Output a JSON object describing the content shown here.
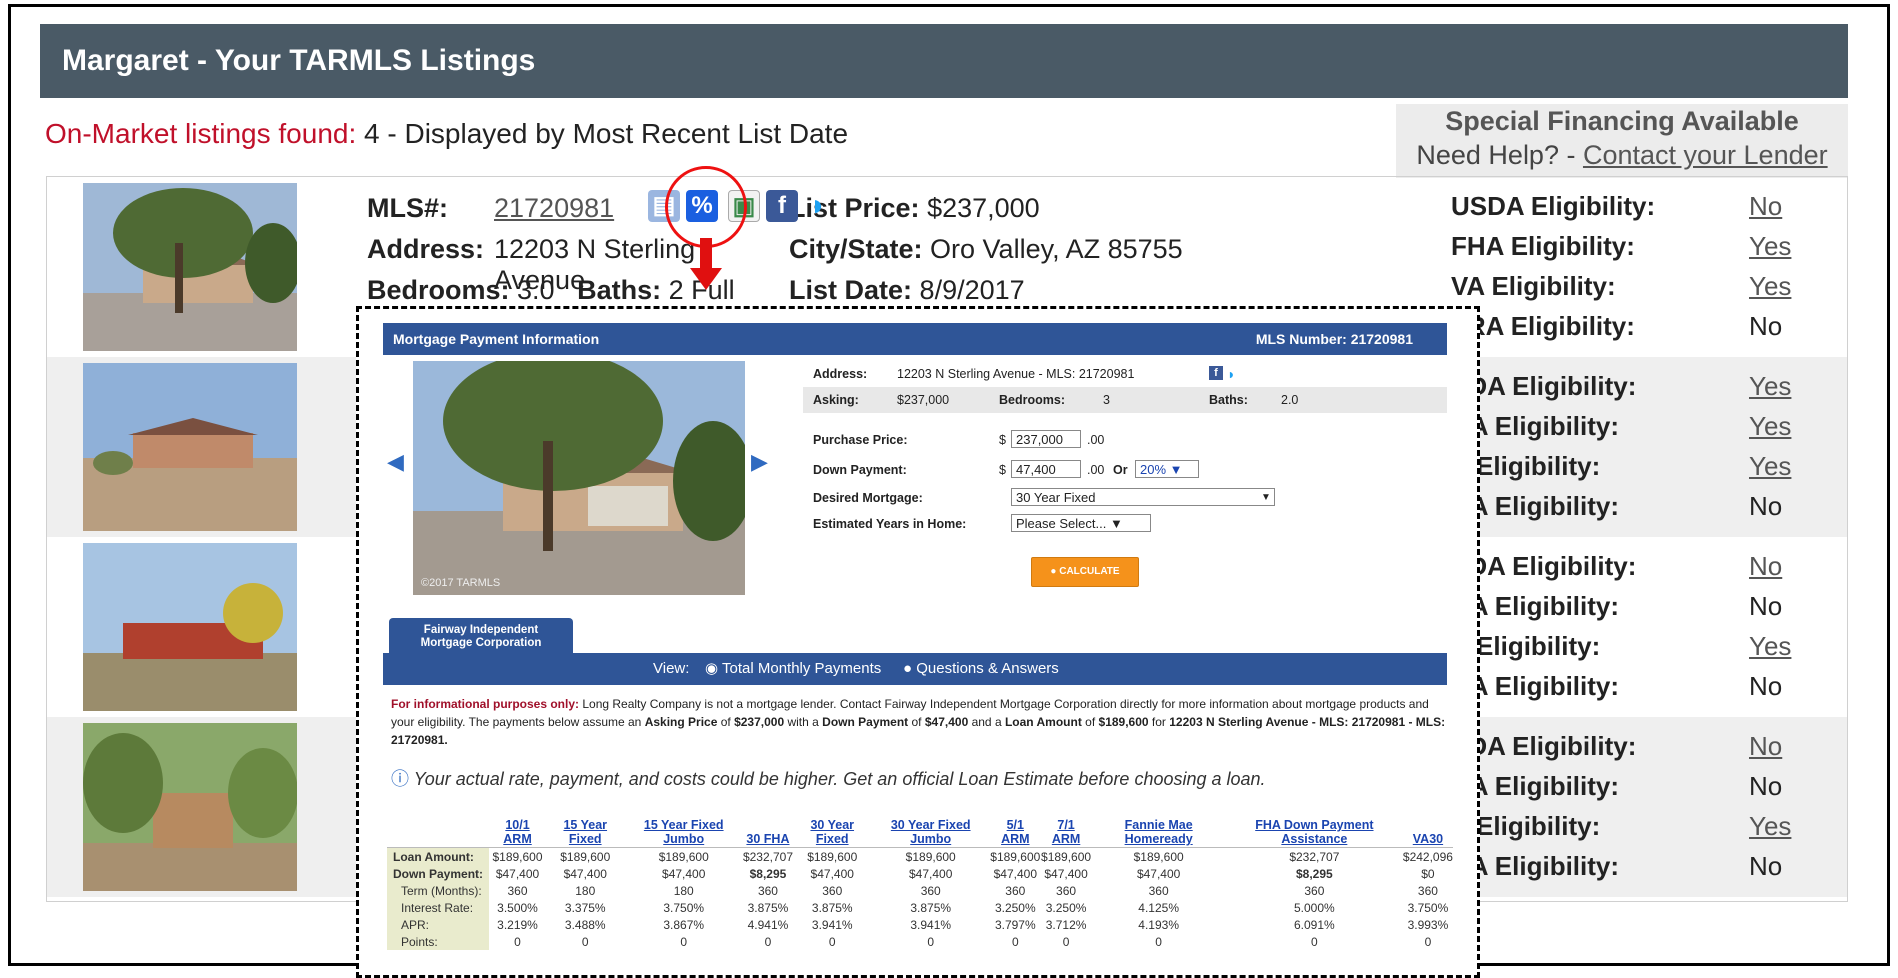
{
  "header": {
    "title": "Margaret - Your TARMLS Listings"
  },
  "found": {
    "label": "On-Market listings found:",
    "count_text": "4 - Displayed by Most Recent List Date"
  },
  "special": {
    "line1": "Special Financing Available",
    "prefix": "Need Help? - ",
    "link": "Contact your Lender"
  },
  "listing1": {
    "mls_label": "MLS#:",
    "mls_number": "21720981",
    "address_label": "Address:",
    "address": "12203 N Sterling Avenue",
    "bedrooms_label": "Bedrooms:",
    "bedrooms": "3.0",
    "baths_label": "Baths:",
    "baths": "2 Full",
    "price_label": "List Price:",
    "price": "$237,000",
    "city_label": "City/State:",
    "city": "Oro Valley, AZ 85755",
    "date_label": "List Date:",
    "date": "8/9/2017"
  },
  "eligibility_labels": {
    "usda": "USDA Eligibility:",
    "fha": "FHA Eligibility:",
    "va": "VA Eligibility:",
    "fra": "FRA Eligibility:"
  },
  "eligibility_partial_labels": {
    "usda": "SDA Eligibility:",
    "fha": "HA Eligibility:",
    "va": "A Eligibility:",
    "fra": "RA Eligibility:"
  },
  "eligibility": [
    {
      "usda": "No",
      "fha": "Yes",
      "va": "Yes",
      "fra": "No"
    },
    {
      "usda": "Yes",
      "fha": "Yes",
      "va": "Yes",
      "fra": "No"
    },
    {
      "usda": "No",
      "fha": "No",
      "va": "Yes",
      "fra": "No"
    },
    {
      "usda": "No",
      "fha": "No",
      "va": "Yes",
      "fra": "No"
    }
  ],
  "icons": [
    "document-icon",
    "percent-icon",
    "photos-icon",
    "facebook-icon",
    "twitter-icon"
  ],
  "popup": {
    "title": "Mortgage Payment Information",
    "mls_number_text": "MLS Number: 21720981",
    "address_label": "Address:",
    "address": "12203 N Sterling Avenue - MLS: 21720981",
    "asking_label": "Asking:",
    "asking": "$237,000",
    "bedrooms_label": "Bedrooms:",
    "bedrooms": "3",
    "baths_label": "Baths:",
    "baths": "2.0",
    "purchase_label": "Purchase Price:",
    "purchase_value": "237,000",
    "down_label": "Down Payment:",
    "down_value": "47,400",
    "dollar": "$",
    "cents": ".00",
    "or": "Or",
    "down_percent": "20% ▼",
    "mortgage_label": "Desired Mortgage:",
    "mortgage_value": "30 Year Fixed",
    "years_label": "Estimated Years in Home:",
    "years_value": "Please Select... ▼",
    "calculate": "CALCULATE",
    "photo_credit": "©2017 TARMLS",
    "tab_line1": "Fairway Independent",
    "tab_line2": "Mortgage Corporation",
    "view_label": "View:",
    "view_opt1": "Total Monthly Payments",
    "view_opt2": "Questions & Answers",
    "note_bold": "For informational purposes only:",
    "note_text": " Long Realty Company is not a mortgage lender. Contact Fairway Independent Mortgage Corporation directly for more information about mortgage products and your eligibility. The payments below assume an ",
    "note_b1": "Asking Price",
    "note_t2": " of ",
    "note_b2": "$237,000",
    "note_t3": " with a ",
    "note_b3": "Down Payment",
    "note_t4": " of ",
    "note_b4": "$47,400",
    "note_t5": " and a ",
    "note_b5": "Loan Amount",
    "note_t6": " of ",
    "note_b6": "$189,600",
    "note_t7": " for ",
    "note_b7": "12203 N Sterling Avenue - MLS: 21720981 - MLS: 21720981.",
    "actual": "Your actual rate, payment, and costs could be higher. Get an official Loan Estimate before choosing a loan.",
    "columns": [
      "10/1 ARM",
      "15 Year Fixed",
      "15 Year Fixed Jumbo",
      "30 FHA",
      "30 Year Fixed",
      "30 Year Fixed Jumbo",
      "5/1 ARM",
      "7/1 ARM",
      "Fannie Mae Homeready",
      "FHA Down Payment Assistance",
      "VA30"
    ],
    "rows": [
      {
        "label": "Loan Amount:",
        "values": [
          "$189,600",
          "$189,600",
          "$189,600",
          "$232,707",
          "$189,600",
          "$189,600",
          "$189,600",
          "$189,600",
          "$189,600",
          "$232,707",
          "$242,096"
        ]
      },
      {
        "label": "Down Payment:",
        "values": [
          "$47,400",
          "$47,400",
          "$47,400",
          "$8,295",
          "$47,400",
          "$47,400",
          "$47,400",
          "$47,400",
          "$47,400",
          "$8,295",
          "$0"
        ]
      },
      {
        "label": "Term (Months):",
        "values": [
          "360",
          "180",
          "180",
          "360",
          "360",
          "360",
          "360",
          "360",
          "360",
          "360",
          "360"
        ]
      },
      {
        "label": "Interest Rate:",
        "values": [
          "3.500%",
          "3.375%",
          "3.750%",
          "3.875%",
          "3.875%",
          "3.875%",
          "3.250%",
          "3.250%",
          "4.125%",
          "5.000%",
          "3.750%"
        ]
      },
      {
        "label": "APR:",
        "values": [
          "3.219%",
          "3.488%",
          "3.867%",
          "4.941%",
          "3.941%",
          "3.941%",
          "3.797%",
          "3.712%",
          "4.193%",
          "6.091%",
          "3.993%"
        ]
      },
      {
        "label": "Points:",
        "values": [
          "0",
          "0",
          "0",
          "0",
          "0",
          "0",
          "0",
          "0",
          "0",
          "0",
          "0"
        ]
      }
    ]
  },
  "colors": {
    "header_bg": "#4a5a66",
    "popup_blue": "#2f5597",
    "highlight_red": "#e01010",
    "calc_orange": "#f5921b"
  }
}
